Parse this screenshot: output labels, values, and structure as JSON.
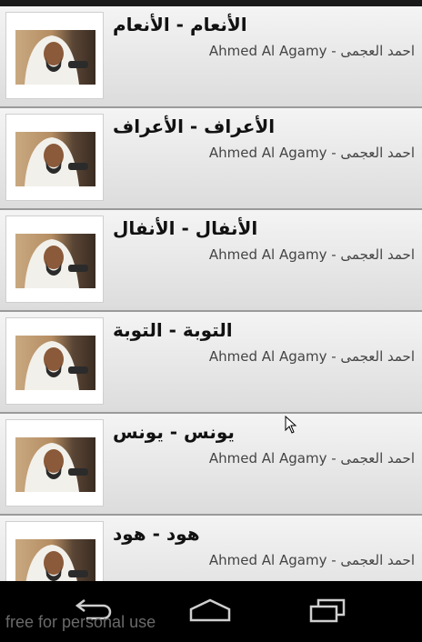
{
  "recitations": [
    {
      "title": "الأنعام - الأنعام",
      "reciter": "احمد العجمى - Ahmed Al Agamy"
    },
    {
      "title": "الأعراف - الأعراف",
      "reciter": "احمد العجمى - Ahmed Al Agamy"
    },
    {
      "title": "الأنفال - الأنفال",
      "reciter": "احمد العجمى - Ahmed Al Agamy"
    },
    {
      "title": "التوبة - التوبة",
      "reciter": "احمد العجمى - Ahmed Al Agamy"
    },
    {
      "title": "يونس - يونس",
      "reciter": "احمد العجمى - Ahmed Al Agamy"
    },
    {
      "title": "هود - هود",
      "reciter": "احمد العجمى - Ahmed Al Agamy"
    }
  ],
  "navigation": {
    "back_icon": "back-arrow-icon",
    "home_icon": "home-icon",
    "recents_icon": "recent-apps-icon"
  },
  "watermark": "free for personal use",
  "colors": {
    "row_background_top": "#f4f4f4",
    "row_background_bottom": "#dcdcdc",
    "row_divider": "#9a9a9a",
    "navbar": "#000000"
  }
}
